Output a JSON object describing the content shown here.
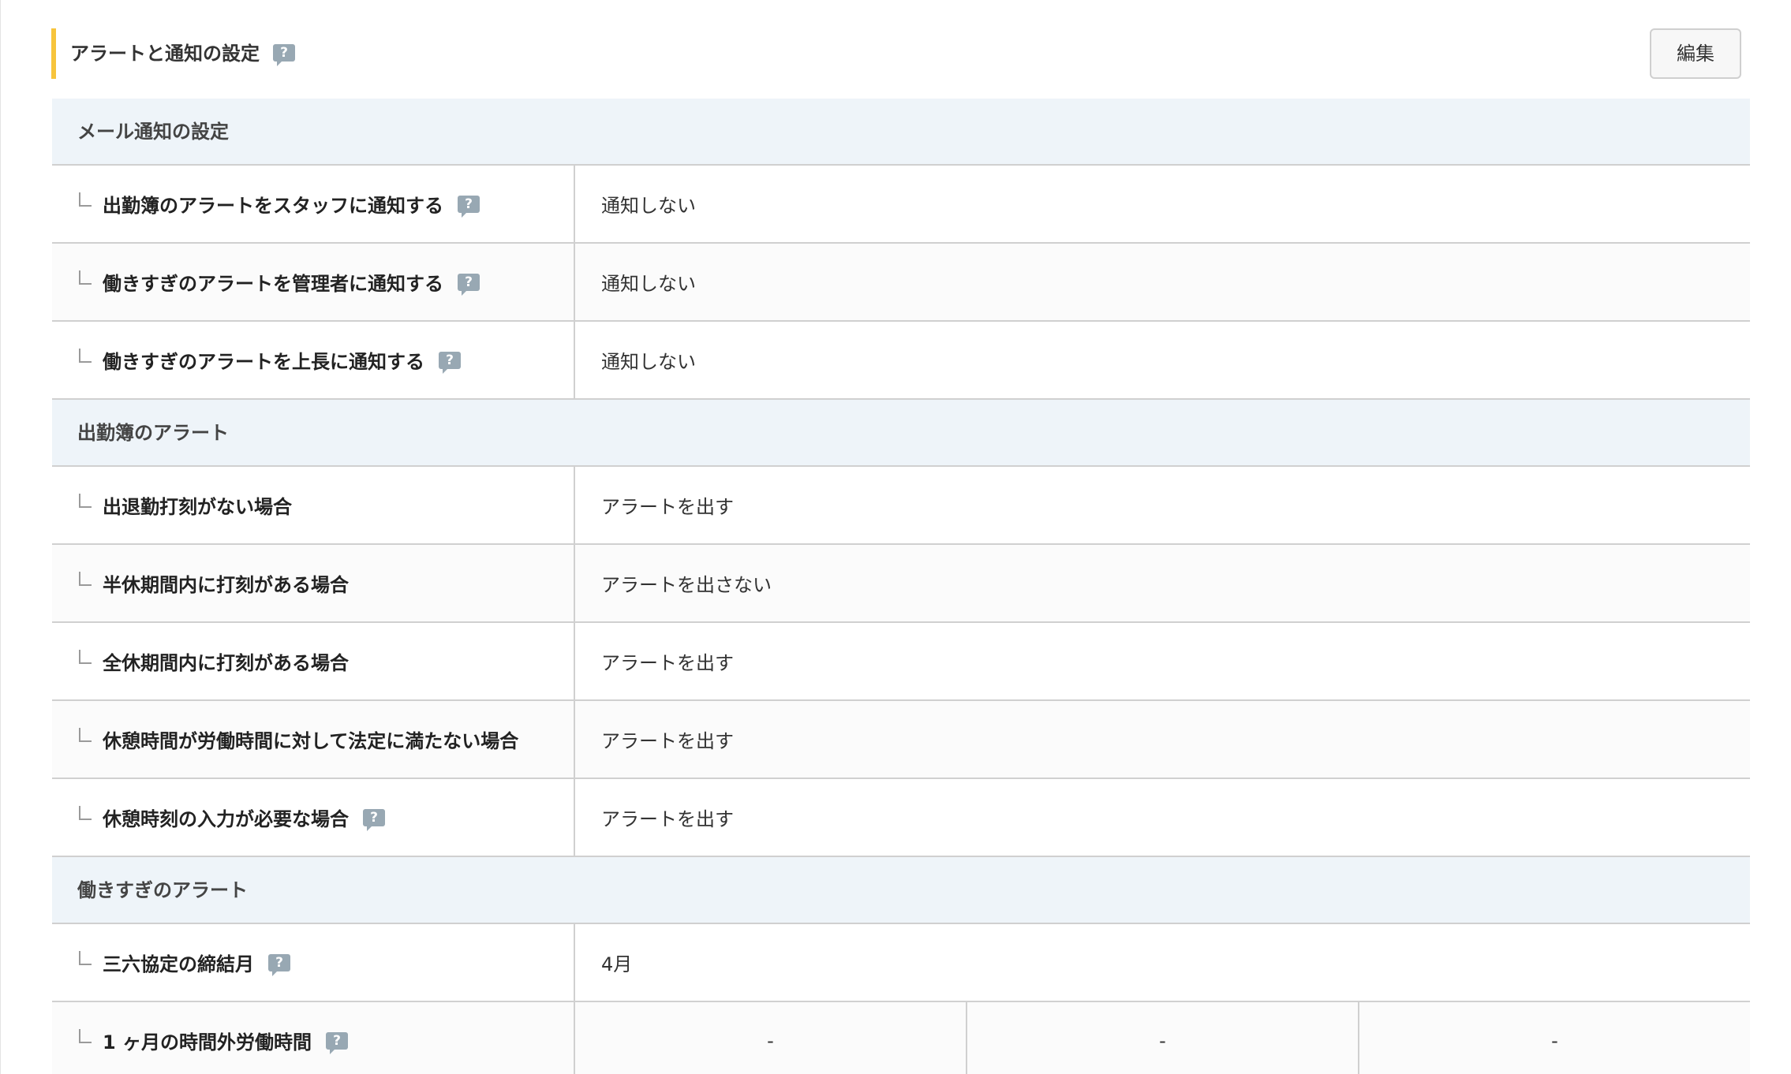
{
  "section": {
    "title": "アラートと通知の設定",
    "help_icon": "?",
    "edit_label": "編集"
  },
  "groups": [
    {
      "header": "メール通知の設定",
      "rows": [
        {
          "label": "出勤簿のアラートをスタッフに通知する",
          "help": true,
          "value": "通知しない"
        },
        {
          "label": "働きすぎのアラートを管理者に通知する",
          "help": true,
          "value": "通知しない"
        },
        {
          "label": "働きすぎのアラートを上長に通知する",
          "help": true,
          "value": "通知しない"
        }
      ]
    },
    {
      "header": "出勤簿のアラート",
      "rows": [
        {
          "label": "出退勤打刻がない場合",
          "help": false,
          "value": "アラートを出す"
        },
        {
          "label": "半休期間内に打刻がある場合",
          "help": false,
          "value": "アラートを出さない"
        },
        {
          "label": "全休期間内に打刻がある場合",
          "help": false,
          "value": "アラートを出す"
        },
        {
          "label": "休憩時間が労働時間に対して法定に満たない場合",
          "help": false,
          "value": "アラートを出す"
        },
        {
          "label": "休憩時刻の入力が必要な場合",
          "help": true,
          "value": "アラートを出す"
        }
      ]
    },
    {
      "header": "働きすぎのアラート",
      "rows": [
        {
          "label": "三六協定の締結月",
          "help": true,
          "value": "4月"
        },
        {
          "label": "1 ヶ月の時間外労働時間",
          "help": true,
          "values": [
            "-",
            "-",
            "-"
          ]
        }
      ]
    }
  ],
  "colors": {
    "accent": "#f7c43c",
    "group_header_bg": "#eef4f9",
    "help_icon_bg": "#98a8b3",
    "border": "#d0d0d0"
  },
  "icons": {
    "help": "question-speech-bubble-icon",
    "branch": "tree-branch-icon"
  }
}
